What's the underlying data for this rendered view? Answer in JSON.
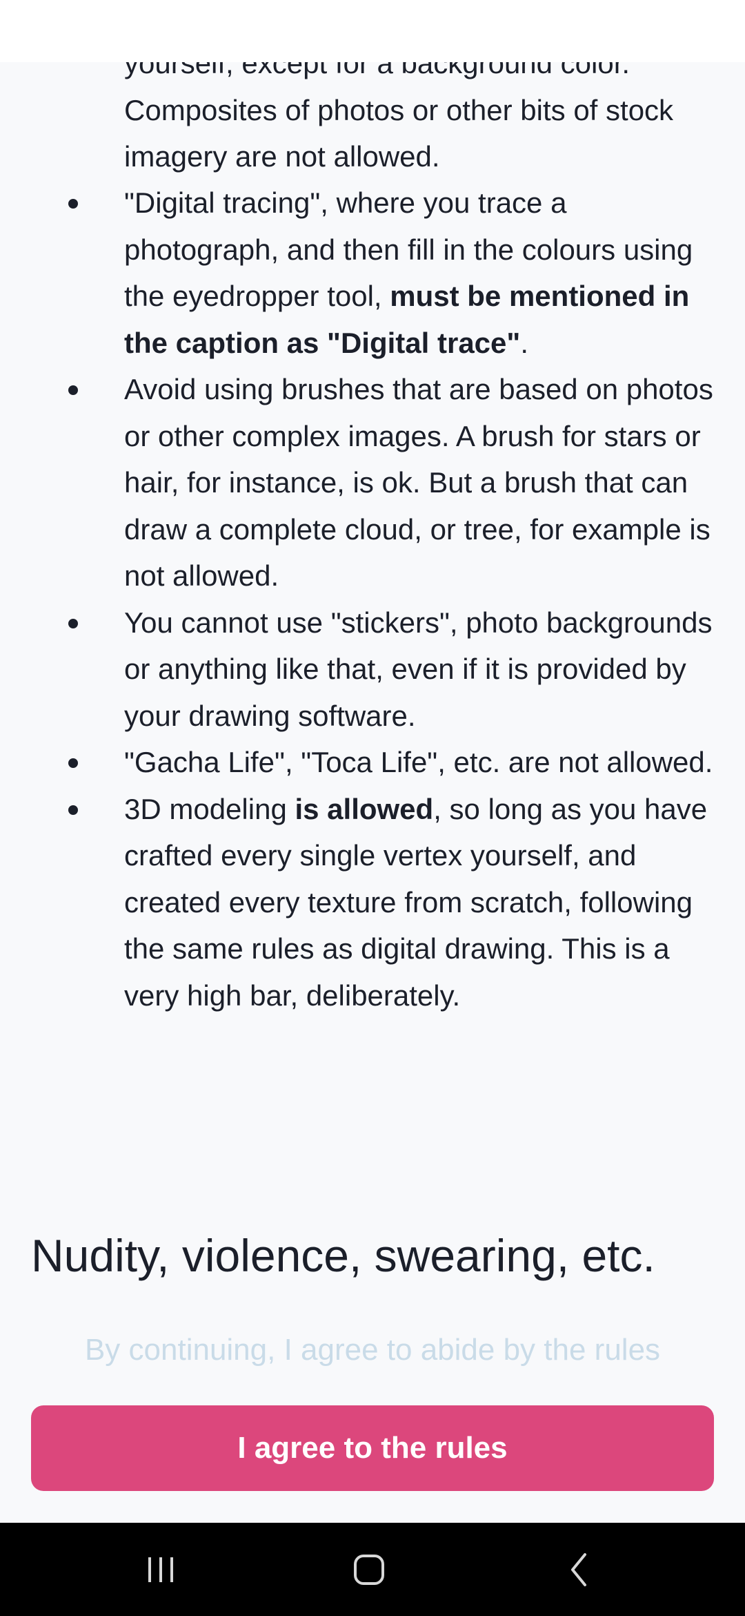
{
  "content": {
    "lead_text": "yourself, except for a background color. Composites of photos or other bits of stock imagery are not allowed.",
    "rules": [
      {
        "before": "\"Digital tracing\", where you trace a photograph, and then fill in the colours using the eyedropper tool, ",
        "bold": "must be mentioned in the caption as \"Digital trace\"",
        "after": "."
      },
      {
        "before": "Avoid using brushes that are based on photos or other complex images. A brush for stars or hair, for instance, is ok. But a brush that can draw a complete cloud, or tree, for example is not allowed.",
        "bold": "",
        "after": ""
      },
      {
        "before": "You cannot use \"stickers\", photo backgrounds or anything like that, even if it is provided by your drawing software.",
        "bold": "",
        "after": ""
      },
      {
        "before": "\"Gacha Life\", \"Toca Life\", etc. are not allowed.",
        "bold": "",
        "after": ""
      },
      {
        "before": "3D modeling ",
        "bold": "is allowed",
        "after": ", so long as you have crafted every single vertex yourself, and created every texture from scratch, following the same rules as digital drawing. This is a very high bar, deliberately."
      }
    ],
    "section_heading": "Nudity, violence, swearing, etc."
  },
  "footer": {
    "notice": "By continuing, I agree to abide by the rules",
    "agree_label": "I agree to the rules"
  },
  "colors": {
    "accent": "#dc477c",
    "notice": "#c9dbe8",
    "text": "#1b1f2a",
    "background": "#f8f9fb"
  },
  "nav": {
    "icons": [
      "recents-icon",
      "home-icon",
      "back-icon"
    ]
  }
}
